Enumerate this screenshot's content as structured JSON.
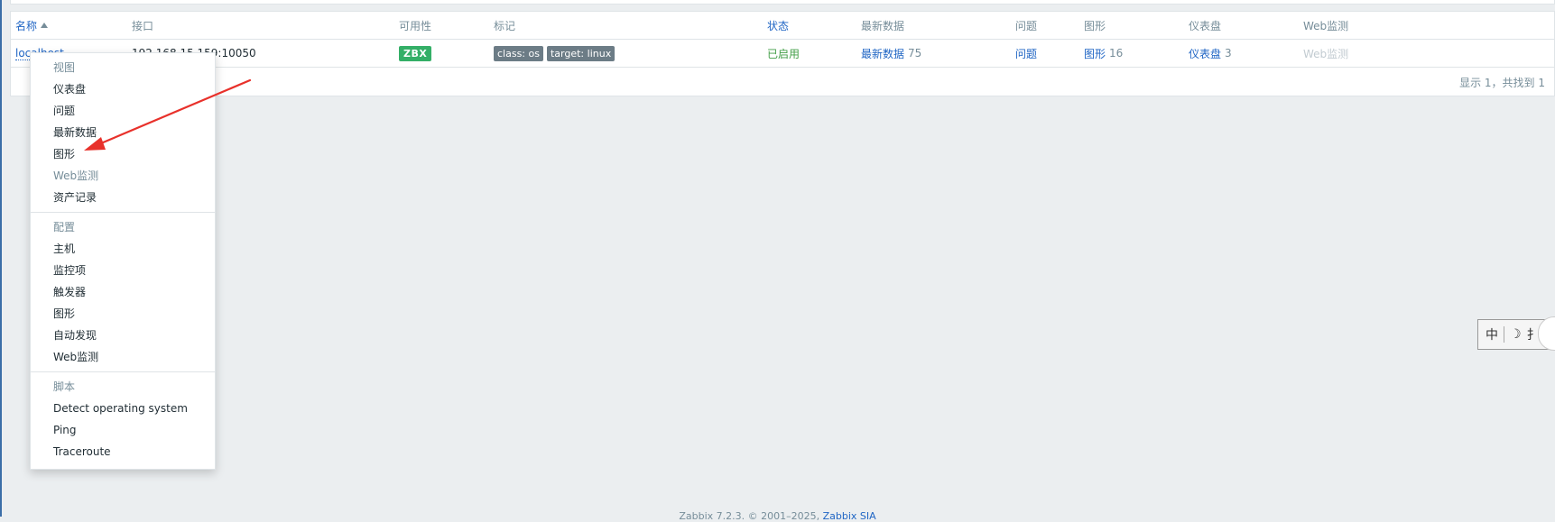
{
  "table": {
    "headers": {
      "name": "名称",
      "interface": "接口",
      "availability": "可用性",
      "tags": "标记",
      "status": "状态",
      "latest_data": "最新数据",
      "problems": "问题",
      "graphs": "图形",
      "dashboards": "仪表盘",
      "web": "Web监测"
    },
    "row": {
      "name": "localhost",
      "interface": "192.168.15.159:10050",
      "availability": "ZBX",
      "tags": [
        "class: os",
        "target: linux"
      ],
      "status": "已启用",
      "latest_data_label": "最新数据",
      "latest_data_count": "75",
      "problems": "问题",
      "graphs_label": "图形",
      "graphs_count": "16",
      "dashboards_label": "仪表盘",
      "dashboards_count": "3",
      "web": "Web监测"
    },
    "footer": "显示 1，共找到 1"
  },
  "context_menu": {
    "view": {
      "heading": "视图",
      "items": [
        "仪表盘",
        "问题",
        "最新数据",
        "图形",
        "Web监测",
        "资产记录"
      ]
    },
    "config": {
      "heading": "配置",
      "items": [
        "主机",
        "监控项",
        "触发器",
        "图形",
        "自动发现",
        "Web监测"
      ]
    },
    "scripts": {
      "heading": "脚本",
      "items": [
        "Detect operating system",
        "Ping",
        "Traceroute"
      ]
    }
  },
  "footer": {
    "text": "Zabbix 7.2.3. © 2001–2025, ",
    "link": "Zabbix SIA"
  },
  "ime": {
    "label1": "中",
    "label2": "☽",
    "label3": "⺘"
  },
  "colors": {
    "link": "#1f65c4",
    "enabled": "#429e47",
    "zbx_badge": "#34af67",
    "tag_bg": "#6c7c86",
    "arrow": "#e8312b"
  }
}
